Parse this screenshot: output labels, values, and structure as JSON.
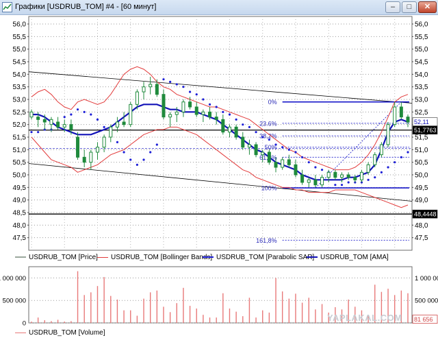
{
  "window": {
    "title": "Графики [USDRUB_TOM] #4 - [60 минут]",
    "buttons": {
      "minimize": "–",
      "maximize": "□",
      "close": "✕"
    }
  },
  "price_axis": {
    "ticks": [
      "56,0",
      "55,5",
      "55,0",
      "54,5",
      "54,0",
      "53,5",
      "53,0",
      "52,5",
      "52,0",
      "51,5",
      "51,0",
      "50,5",
      "50,0",
      "49,5",
      "49,0",
      "48,5",
      "48,0",
      "47,5"
    ]
  },
  "fib": {
    "levels": [
      {
        "label": "0%",
        "value": 52.9
      },
      {
        "label": "23.6%",
        "value": 52.05
      },
      {
        "label": "38,2%",
        "value": 51.55
      },
      {
        "label": "50%",
        "value": 51.1
      },
      {
        "label": "61,8%",
        "value": 50.7
      },
      {
        "label": "100%",
        "value": 49.48
      },
      {
        "label": "161,8%",
        "value": 47.4
      }
    ]
  },
  "markers": {
    "ama_value": "52,11",
    "line_value": "51,7763",
    "low_value": "48,4448"
  },
  "levels": {
    "upper_line": 51.78,
    "lower_line": 48.44
  },
  "legend": {
    "price": "USDRUB_TOM [Price]",
    "bollinger": "USDRUB_TOM [Bollinger Bands]",
    "sar": "USDRUB_TOM [Parabolic SAR]",
    "ama": "USDRUB_TOM [AMA]",
    "volume": "USDRUB_TOM [Volume]"
  },
  "volume_axis": {
    "left_ticks": [
      "1 000 000",
      "500 000",
      "0"
    ],
    "right_ticks": [
      "1 000 000",
      "500 000"
    ],
    "current": "81 656"
  },
  "watermark": "YAPLAKAL.COM",
  "colors": {
    "price": "#1f8a3c",
    "bollinger": "#e23b3b",
    "sar": "#1d1fd6",
    "ama": "#1212b8",
    "volume": "#e87878"
  },
  "chart_data": {
    "type": "candlestick",
    "ylim": [
      47.0,
      56.3
    ],
    "candles": [
      [
        52.3,
        52.6,
        52.2,
        52.5
      ],
      [
        52.3,
        52.5,
        51.9,
        52.2
      ],
      [
        52.2,
        52.4,
        51.8,
        52.1
      ],
      [
        52.0,
        52.3,
        51.7,
        52.2
      ],
      [
        52.1,
        52.3,
        51.8,
        51.9
      ],
      [
        51.9,
        52.2,
        51.7,
        52.0
      ],
      [
        52.0,
        52.2,
        51.6,
        51.8
      ],
      [
        51.5,
        51.7,
        50.6,
        50.7
      ],
      [
        50.7,
        51.0,
        50.3,
        50.5
      ],
      [
        50.5,
        51.0,
        50.2,
        50.9
      ],
      [
        50.9,
        51.3,
        50.6,
        51.1
      ],
      [
        51.1,
        51.6,
        50.9,
        51.5
      ],
      [
        51.5,
        52.0,
        51.3,
        51.9
      ],
      [
        51.9,
        52.3,
        51.7,
        52.1
      ],
      [
        52.1,
        52.5,
        51.9,
        52.0
      ],
      [
        52.0,
        52.9,
        51.9,
        52.8
      ],
      [
        52.8,
        53.4,
        52.6,
        53.3
      ],
      [
        53.3,
        53.7,
        53.0,
        53.5
      ],
      [
        53.5,
        53.9,
        53.2,
        53.6
      ],
      [
        53.6,
        53.8,
        53.1,
        53.2
      ],
      [
        53.2,
        53.4,
        52.2,
        52.3
      ],
      [
        52.3,
        52.5,
        51.9,
        52.4
      ],
      [
        52.4,
        52.7,
        52.1,
        52.5
      ],
      [
        52.5,
        53.0,
        52.3,
        52.9
      ],
      [
        52.9,
        53.1,
        52.6,
        52.7
      ],
      [
        52.7,
        52.9,
        52.3,
        52.4
      ],
      [
        52.4,
        52.6,
        52.1,
        52.5
      ],
      [
        52.5,
        52.7,
        52.2,
        52.3
      ],
      [
        52.3,
        52.5,
        52.0,
        52.2
      ],
      [
        52.2,
        52.4,
        51.6,
        51.7
      ],
      [
        51.7,
        52.0,
        51.5,
        51.9
      ],
      [
        51.9,
        52.0,
        51.4,
        51.5
      ],
      [
        51.5,
        51.7,
        51.0,
        51.1
      ],
      [
        51.1,
        51.4,
        50.8,
        51.2
      ],
      [
        51.2,
        51.3,
        50.7,
        50.8
      ],
      [
        50.8,
        51.0,
        50.5,
        50.9
      ],
      [
        50.9,
        51.0,
        50.4,
        50.5
      ],
      [
        50.5,
        50.7,
        50.1,
        50.3
      ],
      [
        50.3,
        50.7,
        50.2,
        50.6
      ],
      [
        50.6,
        50.8,
        50.3,
        50.4
      ],
      [
        50.4,
        50.6,
        49.9,
        50.0
      ],
      [
        50.0,
        50.2,
        49.6,
        49.7
      ],
      [
        49.7,
        49.9,
        49.5,
        49.8
      ],
      [
        49.8,
        50.0,
        49.5,
        49.6
      ],
      [
        49.6,
        50.0,
        49.5,
        49.9
      ],
      [
        49.9,
        50.2,
        49.7,
        50.1
      ],
      [
        50.1,
        50.2,
        49.8,
        49.9
      ],
      [
        49.9,
        50.1,
        49.7,
        50.0
      ],
      [
        50.0,
        50.1,
        49.8,
        49.9
      ],
      [
        49.9,
        50.0,
        49.7,
        49.8
      ],
      [
        49.8,
        50.2,
        49.7,
        50.1
      ],
      [
        50.1,
        50.5,
        50.0,
        50.4
      ],
      [
        50.4,
        50.9,
        50.3,
        50.8
      ],
      [
        50.8,
        51.3,
        50.7,
        51.2
      ],
      [
        51.2,
        52.1,
        51.1,
        52.0
      ],
      [
        52.0,
        52.9,
        51.9,
        52.7
      ],
      [
        52.7,
        52.9,
        52.2,
        52.3
      ],
      [
        52.3,
        52.4,
        51.9,
        52.1
      ]
    ],
    "volume": [
      30,
      120,
      60,
      40,
      70,
      30,
      40,
      1150,
      620,
      680,
      820,
      1020,
      600,
      520,
      280,
      280,
      160,
      540,
      680,
      720,
      360,
      240,
      440,
      780,
      380,
      320,
      180,
      120,
      120,
      660,
      320,
      250,
      150,
      560,
      120,
      280,
      230,
      1000,
      700,
      540,
      650,
      450,
      560,
      300,
      420,
      230,
      350,
      300,
      520,
      360,
      280,
      160,
      850,
      690,
      760,
      620,
      720,
      660
    ],
    "bollinger_upper": [
      53.1,
      53.3,
      53.4,
      53.2,
      52.9,
      52.7,
      52.6,
      52.9,
      53.0,
      52.9,
      52.8,
      52.9,
      53.2,
      53.6,
      54.0,
      54.2,
      54.3,
      54.2,
      54.0,
      53.7,
      53.5,
      53.4,
      53.2,
      53.1,
      53.0,
      52.9,
      52.8,
      52.7,
      52.7,
      52.6,
      52.5,
      52.4,
      52.3,
      52.2,
      52.0,
      51.8,
      51.6,
      51.4,
      51.2,
      51.0,
      50.9,
      50.7,
      50.6,
      50.5,
      50.4,
      50.3,
      50.2,
      50.2,
      50.2,
      50.3,
      50.5,
      50.8,
      51.2,
      51.7,
      52.3,
      52.9,
      53.1,
      53.2
    ],
    "bollinger_lower": [
      51.5,
      51.2,
      50.9,
      50.6,
      50.5,
      50.4,
      50.3,
      50.1,
      50.2,
      50.3,
      50.4,
      50.6,
      50.8,
      50.9,
      51.0,
      51.2,
      51.4,
      51.6,
      51.7,
      51.8,
      51.8,
      51.9,
      51.9,
      51.8,
      51.7,
      51.6,
      51.4,
      51.2,
      51.0,
      50.8,
      50.6,
      50.4,
      50.2,
      50.1,
      49.9,
      49.8,
      49.7,
      49.6,
      49.5,
      49.5,
      49.4,
      49.4,
      49.3,
      49.3,
      49.3,
      49.3,
      49.4,
      49.4,
      49.4,
      49.4,
      49.3,
      49.2,
      49.1,
      49.0,
      48.9,
      48.8,
      48.7,
      48.8
    ],
    "ama": [
      52.4,
      52.4,
      52.3,
      52.1,
      51.9,
      51.8,
      51.7,
      51.6,
      51.6,
      51.6,
      51.7,
      51.8,
      51.9,
      52.1,
      52.3,
      52.5,
      52.7,
      52.8,
      52.8,
      52.8,
      52.7,
      52.6,
      52.6,
      52.5,
      52.5,
      52.5,
      52.4,
      52.3,
      52.2,
      52.0,
      51.8,
      51.6,
      51.4,
      51.2,
      51.0,
      50.9,
      50.7,
      50.5,
      50.4,
      50.3,
      50.2,
      50.0,
      49.9,
      49.8,
      49.8,
      49.8,
      49.8,
      49.8,
      49.9,
      49.9,
      50.0,
      50.1,
      50.4,
      51.0,
      51.7,
      52.1,
      52.2,
      52.1
    ],
    "sar": [
      51.7,
      51.7,
      51.8,
      51.8,
      51.9,
      52.3,
      52.4,
      52.6,
      52.5,
      52.4,
      52.2,
      51.9,
      51.6,
      51.3,
      50.9,
      50.6,
      50.4,
      50.6,
      50.9,
      51.2,
      53.8,
      53.7,
      53.6,
      53.5,
      53.3,
      53.2,
      53.0,
      52.8,
      52.7,
      52.5,
      52.4,
      52.2,
      52.0,
      51.9,
      51.7,
      51.5,
      51.4,
      51.2,
      51.1,
      51.0,
      50.9,
      50.7,
      50.5,
      50.3,
      50.2,
      50.1,
      49.6,
      49.6,
      49.7,
      49.7,
      49.7,
      49.8,
      49.9,
      50.1,
      50.3,
      50.5,
      50.7,
      50.9
    ],
    "channel": {
      "upper": [
        54.1,
        52.85
      ],
      "lower": [
        50.45,
        48.95
      ]
    }
  }
}
